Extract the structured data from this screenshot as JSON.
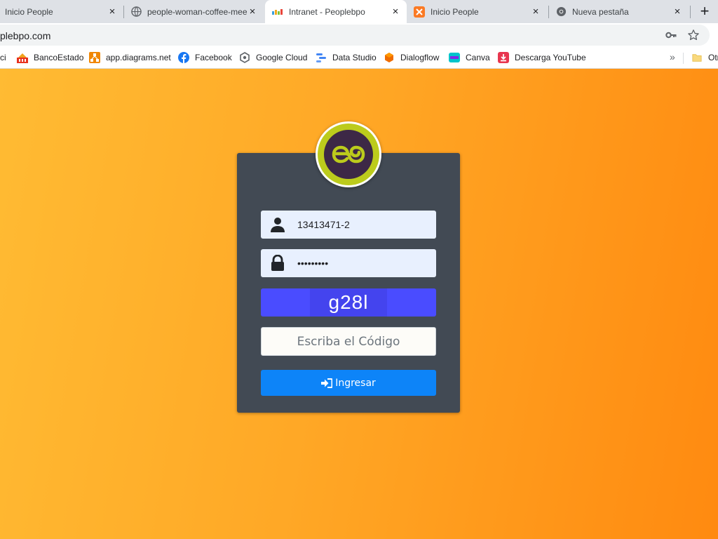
{
  "browser": {
    "tabs": [
      {
        "title": "Inicio People",
        "close": "×"
      },
      {
        "title": "people-woman-coffee-mee",
        "close": "×"
      },
      {
        "title": "Intranet - Peoplebpo",
        "close": "×"
      },
      {
        "title": "Inicio People",
        "close": "×"
      },
      {
        "title": "Nueva pestaña",
        "close": "×"
      }
    ],
    "new_tab": "+",
    "url": "plebpo.com",
    "icons": {
      "key": "key-icon",
      "star": "star-icon"
    }
  },
  "bookmarks": {
    "items": [
      {
        "label": "ci"
      },
      {
        "label": "BancoEstado",
        "icon": "bancoestado-icon"
      },
      {
        "label": "app.diagrams.net",
        "icon": "diagrams-icon"
      },
      {
        "label": "Facebook",
        "icon": "facebook-icon"
      },
      {
        "label": "Google Cloud",
        "icon": "google-cloud-icon"
      },
      {
        "label": "Data Studio",
        "icon": "data-studio-icon"
      },
      {
        "label": "Dialogflow",
        "icon": "dialogflow-icon"
      },
      {
        "label": "Canva",
        "icon": "canva-icon"
      },
      {
        "label": "Descarga YouTube",
        "icon": "youtube-download-icon"
      }
    ],
    "more": "»",
    "other": "Otr"
  },
  "login": {
    "username": "13413471-2",
    "password": "•••••••••",
    "captcha": "g28l",
    "code_placeholder": "Escriba el Código",
    "submit_label": "Ingresar"
  },
  "colors": {
    "card": "#424a54",
    "captcha": "#4a4cff",
    "button": "#0d84f8",
    "logo_ring": "#bccb1c",
    "logo_core": "#3d2846"
  }
}
